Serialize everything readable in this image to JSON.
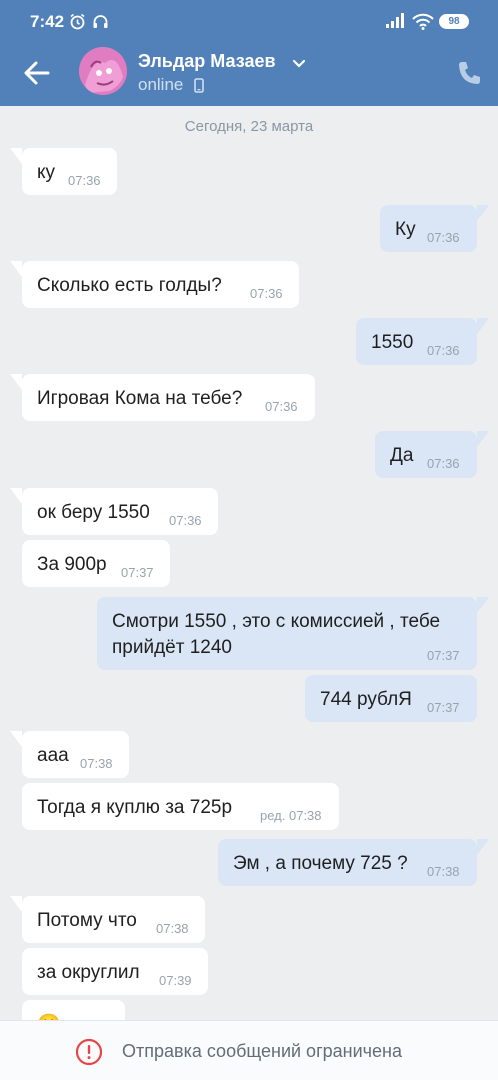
{
  "status_bar": {
    "time": "7:42",
    "battery": "98"
  },
  "header": {
    "contact_name": "Эльдар Мазаев",
    "presence": "online",
    "icons": [
      "back-arrow-icon",
      "chevron-down-icon",
      "mobile-icon",
      "phone-icon"
    ],
    "color": "#5181b8"
  },
  "chat": {
    "date_separator": "Сегодня, 23 марта",
    "messages": [
      {
        "dir": "in",
        "text": "ку",
        "time": "07:36"
      },
      {
        "dir": "out",
        "text": "Ку",
        "time": "07:36"
      },
      {
        "dir": "in",
        "text": "Сколько есть голды?",
        "time": "07:36"
      },
      {
        "dir": "out",
        "text": "1550",
        "time": "07:36"
      },
      {
        "dir": "in",
        "text": "Игровая Кома на тебе?",
        "time": "07:36"
      },
      {
        "dir": "out",
        "text": "Да",
        "time": "07:36"
      },
      {
        "dir": "in",
        "text": "ок беру 1550",
        "time": "07:36"
      },
      {
        "dir": "in",
        "text": "За 900р",
        "time": "07:37"
      },
      {
        "dir": "out",
        "text": "Смотри 1550 , это с комиссией , тебе прийдёт 1240",
        "time": "07:37"
      },
      {
        "dir": "out",
        "text": "744 рублЯ",
        "time": "07:37"
      },
      {
        "dir": "in",
        "text": "ааа",
        "time": "07:38"
      },
      {
        "dir": "in",
        "text": "Тогда я куплю за 725р",
        "time": "ред. 07:38"
      },
      {
        "dir": "out",
        "text": "Эм , а почему 725 ?",
        "time": "07:38"
      },
      {
        "dir": "in",
        "text": "Потому что",
        "time": "07:38"
      },
      {
        "dir": "in",
        "text": "за округлил",
        "time": "07:39"
      },
      {
        "dir": "in",
        "text": "🙂",
        "time": ""
      }
    ]
  },
  "bottom_bar": {
    "text": "Отправка сообщений ограничена",
    "icon": "warning-circle-icon"
  }
}
